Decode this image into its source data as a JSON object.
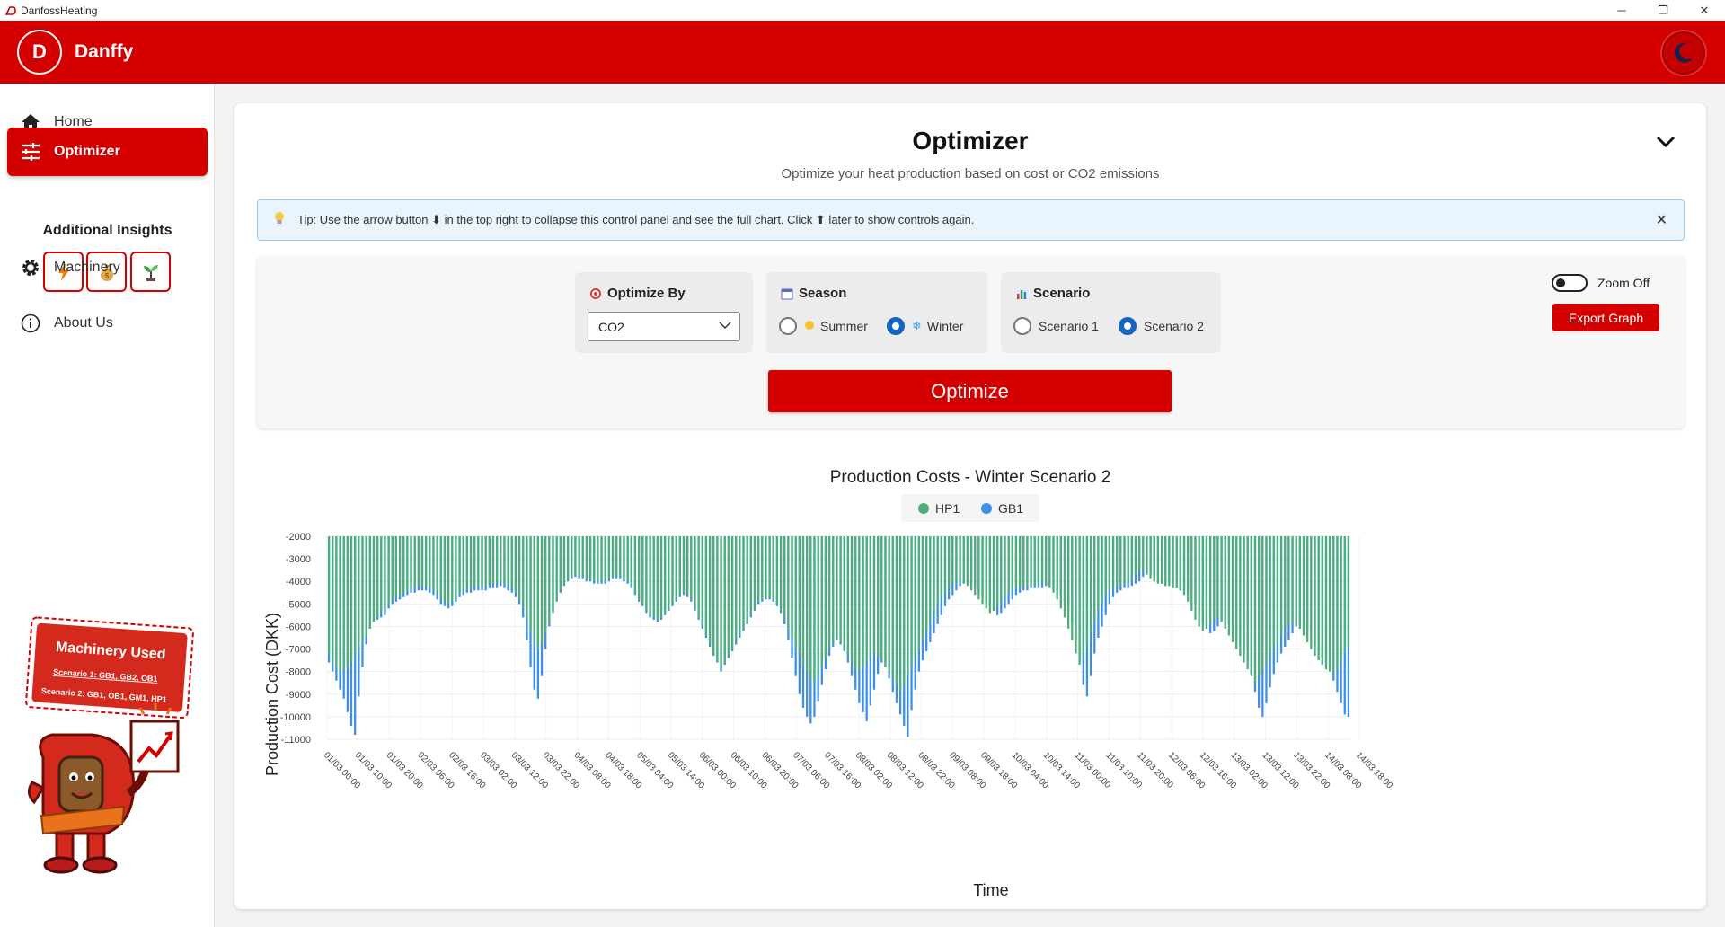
{
  "window": {
    "title": "DanfossHeating",
    "controls": [
      "─",
      "❐",
      "✕"
    ]
  },
  "appbar": {
    "logo_letter": "D",
    "brand": "Danffy",
    "theme_icon": "moon-icon"
  },
  "sidebar": {
    "items": [
      {
        "label": "Home",
        "icon": "home-icon",
        "active": false
      },
      {
        "label": "Optimizer",
        "icon": "sliders-icon",
        "active": true
      },
      {
        "label": "Machinery",
        "icon": "gear-icon",
        "active": false
      },
      {
        "label": "About Us",
        "icon": "info-icon",
        "active": false
      }
    ],
    "insights_title": "Additional Insights",
    "insight_buttons": [
      "electricity-icon",
      "money-bag-icon",
      "seedling-icon"
    ],
    "mascot": {
      "title": "Machinery Used",
      "scenario1": "Scenario 1: GB1, GB2, OB1",
      "scenario2": "Scenario 2: GB1, OB1, GM1, HP1"
    }
  },
  "optimizer": {
    "title": "Optimizer",
    "subtitle": "Optimize your heat production based on cost or CO2 emissions",
    "tip": "Tip: Use the arrow button ⬇ in the top right to collapse this control panel and see the full chart. Click ⬆ later to show controls again.",
    "optimize_by": {
      "label": "Optimize By",
      "value": "CO2"
    },
    "season": {
      "label": "Season",
      "options": [
        "Summer",
        "Winter"
      ],
      "selected": "Winter"
    },
    "scenario": {
      "label": "Scenario",
      "options": [
        "Scenario 1",
        "Scenario 2"
      ],
      "selected": "Scenario 2"
    },
    "zoom_label": "Zoom Off",
    "export_label": "Export Graph",
    "optimize_label": "Optimize"
  },
  "colors": {
    "brand_red": "#d40000",
    "hp1_green": "#4caf7a",
    "gb1_blue": "#3d8fe8",
    "radio_blue": "#1565c0"
  },
  "chart_data": {
    "type": "bar",
    "title": "Production Costs - Winter Scenario 2",
    "xlabel": "Time",
    "ylabel": "Production Cost (DKK)",
    "ylim": [
      -11000,
      -2000
    ],
    "yticks": [
      -2000,
      -3000,
      -4000,
      -5000,
      -6000,
      -7000,
      -8000,
      -9000,
      -10000,
      -11000
    ],
    "legend_position": "top-center",
    "x_tick_labels": [
      "01/03 00:00",
      "01/03 10:00",
      "01/03 20:00",
      "02/03 06:00",
      "02/03 16:00",
      "03/03 02:00",
      "03/03 12:00",
      "03/03 22:00",
      "04/03 08:00",
      "04/03 18:00",
      "05/03 04:00",
      "05/03 14:00",
      "06/03 00:00",
      "06/03 10:00",
      "06/03 20:00",
      "07/03 06:00",
      "07/03 16:00",
      "08/03 02:00",
      "08/03 12:00",
      "08/03 22:00",
      "09/03 08:00",
      "09/03 18:00",
      "10/03 04:00",
      "10/03 14:00",
      "11/03 00:00",
      "11/03 10:00",
      "11/03 20:00",
      "12/03 06:00",
      "12/03 16:00",
      "13/03 02:00",
      "13/03 12:00",
      "13/03 22:00",
      "14/03 08:00",
      "14/03 18:00"
    ],
    "series": [
      {
        "name": "HP1",
        "color": "#4caf7a",
        "values": [
          -7200,
          -7600,
          -7800,
          -8000,
          -7900,
          -7800,
          -7600,
          -7300,
          -7000,
          -6700,
          -6400,
          -6100,
          -5800,
          -5600,
          -5400,
          -5200,
          -5000,
          -4800,
          -4700,
          -4600,
          -4500,
          -4400,
          -4300,
          -4300,
          -4200,
          -4200,
          -4200,
          -4300,
          -4400,
          -4600,
          -4800,
          -4900,
          -5000,
          -4900,
          -4700,
          -4500,
          -4400,
          -4300,
          -4300,
          -4200,
          -4200,
          -4200,
          -4200,
          -4100,
          -4100,
          -4100,
          -4000,
          -4100,
          -4200,
          -4300,
          -4500,
          -4800,
          -5200,
          -5700,
          -6200,
          -6700,
          -7000,
          -6700,
          -6300,
          -5800,
          -5300,
          -4800,
          -4400,
          -4100,
          -3900,
          -3800,
          -3700,
          -3800,
          -3800,
          -3900,
          -3900,
          -4000,
          -4000,
          -4000,
          -4000,
          -3900,
          -3800,
          -3800,
          -3800,
          -3900,
          -4000,
          -4200,
          -4500,
          -4800,
          -5000,
          -5300,
          -5500,
          -5600,
          -5700,
          -5600,
          -5400,
          -5200,
          -5000,
          -4800,
          -4600,
          -4500,
          -4600,
          -4800,
          -5200,
          -5600,
          -6000,
          -6400,
          -6800,
          -7200,
          -7500,
          -7800,
          -7600,
          -7300,
          -7000,
          -6700,
          -6400,
          -6100,
          -5800,
          -5500,
          -5200,
          -4900,
          -4800,
          -4700,
          -4700,
          -4800,
          -5000,
          -5300,
          -5700,
          -6100,
          -6500,
          -6900,
          -7300,
          -7700,
          -8000,
          -8300,
          -8500,
          -8200,
          -7800,
          -7400,
          -7000,
          -6700,
          -6500,
          -6700,
          -7000,
          -7300,
          -7600,
          -7800,
          -8000,
          -7800,
          -7600,
          -7400,
          -7200,
          -7300,
          -7500,
          -7800,
          -8000,
          -8300,
          -8600,
          -8900,
          -8600,
          -8200,
          -7800,
          -7400,
          -7000,
          -6600,
          -6200,
          -5800,
          -5400,
          -5000,
          -4700,
          -4500,
          -4300,
          -4100,
          -4000,
          -4000,
          -4100,
          -4200,
          -4400,
          -4600,
          -4800,
          -5000,
          -5200,
          -5400,
          -5300,
          -5100,
          -4900,
          -4700,
          -4500,
          -4400,
          -4300,
          -4300,
          -4200,
          -4200,
          -4200,
          -4200,
          -4100,
          -4100,
          -4200,
          -4300,
          -4500,
          -4800,
          -5200,
          -5600,
          -6100,
          -6600,
          -7200,
          -7700,
          -7300,
          -6800,
          -6300,
          -5800,
          -5300,
          -4900,
          -4600,
          -4400,
          -4300,
          -4200,
          -4200,
          -4100,
          -4000,
          -3900,
          -3700,
          -3500,
          -3500,
          -3700,
          -3900,
          -4000,
          -4100,
          -4100,
          -4200,
          -4200,
          -4300,
          -4300,
          -4400,
          -4600,
          -4900,
          -5300,
          -5700,
          -6000,
          -6200,
          -6100,
          -5900,
          -5700,
          -5600,
          -5800,
          -6100,
          -6400,
          -6700,
          -7000,
          -7300,
          -7600,
          -7900,
          -8200,
          -8500,
          -8200,
          -7900,
          -7600,
          -7300,
          -7000,
          -6700,
          -6400,
          -6100,
          -5900,
          -5800,
          -5900,
          -6100,
          -6400,
          -6700,
          -7000,
          -7300,
          -7500,
          -7700,
          -7900,
          -8000,
          -8100,
          -7900,
          -7600,
          -7200,
          -6900
        ]
      },
      {
        "name": "GB1",
        "color": "#3d8fe8",
        "values": [
          -7600,
          -8000,
          -8400,
          -8800,
          -9200,
          -9800,
          -10400,
          -10800,
          -9100,
          -7800,
          -6800,
          -6100,
          -5800,
          -5700,
          -5600,
          -5500,
          -5200,
          -5000,
          -4900,
          -4800,
          -4700,
          -4600,
          -4500,
          -4500,
          -4400,
          -4400,
          -4400,
          -4500,
          -4600,
          -4800,
          -5000,
          -5100,
          -5200,
          -5100,
          -4900,
          -4700,
          -4600,
          -4500,
          -4500,
          -4400,
          -4400,
          -4400,
          -4400,
          -4300,
          -4300,
          -4300,
          -4200,
          -4300,
          -4400,
          -4500,
          -4700,
          -5000,
          -5600,
          -6600,
          -7800,
          -8800,
          -9200,
          -8200,
          -7000,
          -6000,
          -5400,
          -4900,
          -4500,
          -4200,
          -4000,
          -3900,
          -3800,
          -3900,
          -3900,
          -4000,
          -4000,
          -4100,
          -4100,
          -4100,
          -4100,
          -4000,
          -3900,
          -3900,
          -3900,
          -4000,
          -4100,
          -4300,
          -4600,
          -4900,
          -5100,
          -5400,
          -5600,
          -5700,
          -5800,
          -5700,
          -5500,
          -5300,
          -5100,
          -4900,
          -4700,
          -4600,
          -4700,
          -4900,
          -5300,
          -5700,
          -6100,
          -6500,
          -6900,
          -7300,
          -7600,
          -8000,
          -7700,
          -7400,
          -7100,
          -6800,
          -6500,
          -6200,
          -5900,
          -5600,
          -5300,
          -5000,
          -4900,
          -4800,
          -4800,
          -4900,
          -5100,
          -5400,
          -5900,
          -6600,
          -7400,
          -8200,
          -9000,
          -9600,
          -10000,
          -10300,
          -10000,
          -9300,
          -8600,
          -7900,
          -7300,
          -6900,
          -6600,
          -6800,
          -7100,
          -7600,
          -8200,
          -8800,
          -9400,
          -9800,
          -10200,
          -9500,
          -8800,
          -8100,
          -7600,
          -7800,
          -8300,
          -8900,
          -9400,
          -9900,
          -10400,
          -10900,
          -9700,
          -8800,
          -8000,
          -7500,
          -7100,
          -6700,
          -6300,
          -5900,
          -5500,
          -5100,
          -4800,
          -4600,
          -4400,
          -4200,
          -4100,
          -4100,
          -4200,
          -4300,
          -4500,
          -4700,
          -4900,
          -5100,
          -5300,
          -5500,
          -5400,
          -5200,
          -5000,
          -4800,
          -4600,
          -4500,
          -4400,
          -4400,
          -4300,
          -4300,
          -4300,
          -4300,
          -4200,
          -4200,
          -4300,
          -4400,
          -4600,
          -4900,
          -5300,
          -5800,
          -6600,
          -7600,
          -8600,
          -9100,
          -8200,
          -7200,
          -6500,
          -6000,
          -5500,
          -5000,
          -4700,
          -4500,
          -4400,
          -4300,
          -4300,
          -4200,
          -4100,
          -4000,
          -3800,
          -3600,
          -3600,
          -3800,
          -4000,
          -4100,
          -4200,
          -4200,
          -4300,
          -4300,
          -4400,
          -4400,
          -4500,
          -4700,
          -5000,
          -5400,
          -5800,
          -6100,
          -6300,
          -6200,
          -6000,
          -5800,
          -5700,
          -5900,
          -6200,
          -6500,
          -6800,
          -7100,
          -7500,
          -8100,
          -8900,
          -9600,
          -10000,
          -9400,
          -8700,
          -8100,
          -7600,
          -7200,
          -6900,
          -6600,
          -6300,
          -6000,
          -5900,
          -6000,
          -6200,
          -6500,
          -6800,
          -7100,
          -7400,
          -7600,
          -7900,
          -8400,
          -8900,
          -9400,
          -9900,
          -10000,
          -9000,
          -8300,
          -7800,
          -7200,
          -6900
        ]
      }
    ]
  }
}
